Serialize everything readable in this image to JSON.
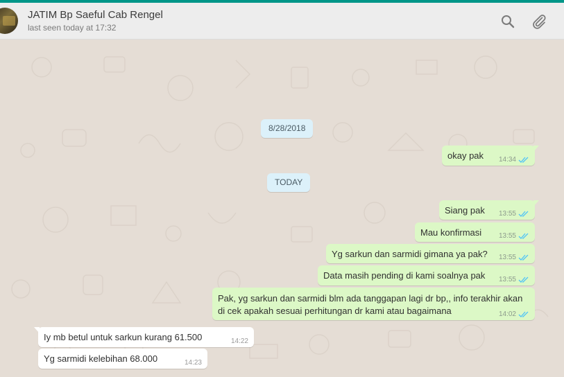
{
  "header": {
    "title": "JATIM Bp Saeful Cab Rengel",
    "subtitle": "last seen today at 17:32"
  },
  "icons": {
    "search": "search-icon",
    "attach": "paperclip-icon",
    "read": "double-check-icon"
  },
  "colors": {
    "accent": "#009688",
    "outgoing": "#dcf8c6",
    "incoming": "#ffffff",
    "read_ticks": "#4fc3f7",
    "date_chip": "#dcf1fa"
  },
  "dates": {
    "first": "8/28/2018",
    "second": "TODAY"
  },
  "messages": [
    {
      "dir": "out",
      "text": "okay pak",
      "time": "14:34",
      "read": true
    },
    {
      "dir": "out",
      "text": "Siang pak",
      "time": "13:55",
      "read": true
    },
    {
      "dir": "out",
      "text": "Mau konfirmasi",
      "time": "13:55",
      "read": true
    },
    {
      "dir": "out",
      "text": "Yg sarkun dan sarmidi gimana ya pak?",
      "time": "13:55",
      "read": true
    },
    {
      "dir": "out",
      "text": "Data masih pending di kami soalnya pak",
      "time": "13:55",
      "read": true
    },
    {
      "dir": "out",
      "text": "Pak, yg sarkun dan sarmidi blm ada tanggapan lagi dr bp,, info terakhir akan di cek apakah sesuai perhitungan dr kami atau bagaimana",
      "time": "14:02",
      "read": true
    },
    {
      "dir": "in",
      "text": "Iy mb betul untuk sarkun kurang 61.500",
      "time": "14:22"
    },
    {
      "dir": "in",
      "text": "Yg sarmidi kelebihan 68.000",
      "time": "14:23"
    }
  ]
}
